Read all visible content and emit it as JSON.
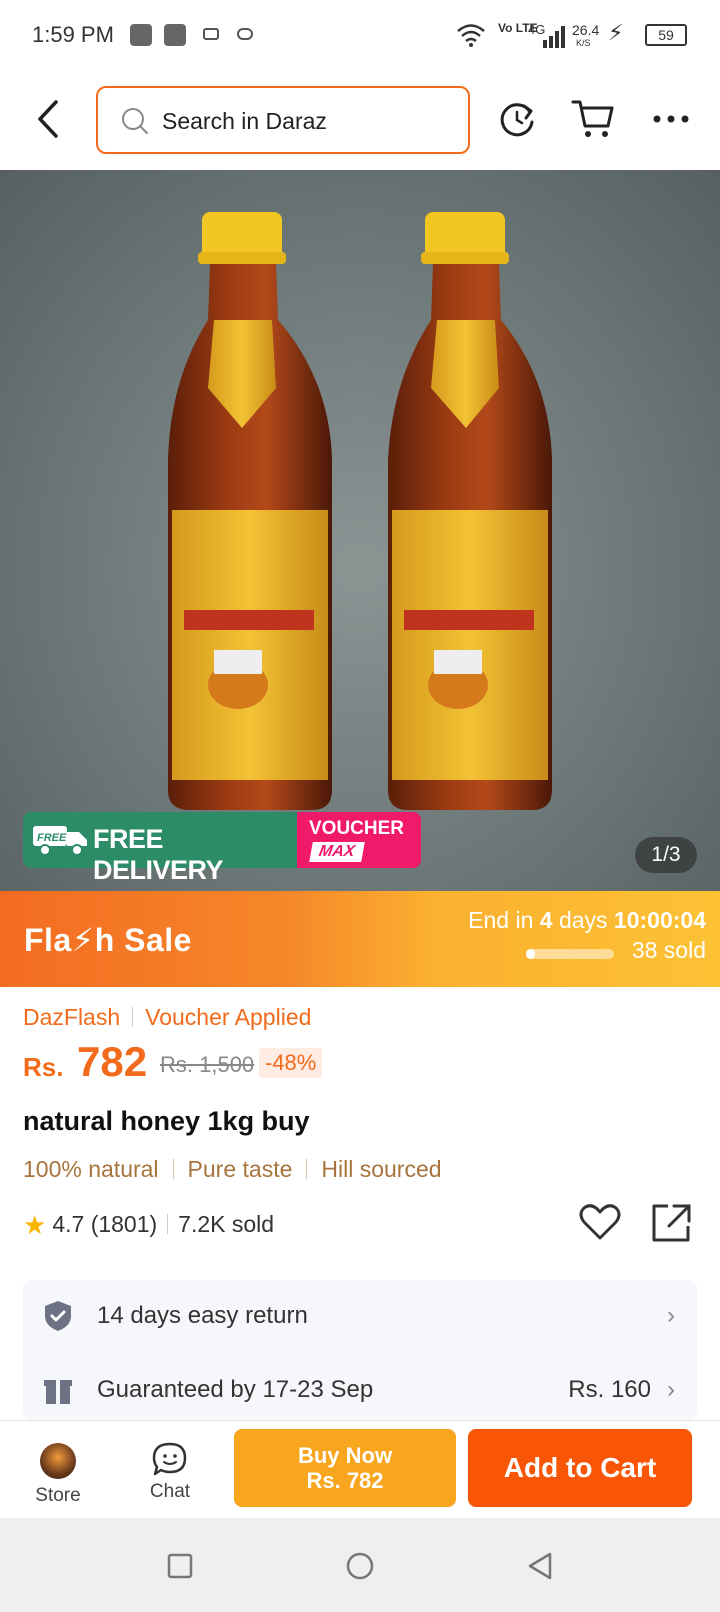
{
  "status_bar": {
    "time": "1:59 PM",
    "network_speed": "26.4",
    "network_speed_unit": "K/S",
    "network_type": "4G",
    "volte": "Vo LTE",
    "battery": "59"
  },
  "header": {
    "search_placeholder": "Search in Daraz"
  },
  "gallery": {
    "pager": "1/3",
    "badge_free_small": "FREE",
    "badge_free_delivery": "FREE DELIVERY",
    "badge_voucher": "VOUCHER",
    "badge_voucher_max": "MAX"
  },
  "flash_sale": {
    "title": "Fla⚡h  Sale",
    "end_prefix": "End in",
    "end_days": "4",
    "end_days_label": "days",
    "end_time": "10:00:04",
    "sold": "38 sold",
    "progress": 0.1
  },
  "product": {
    "tag_1": "DazFlash",
    "tag_2": "Voucher Applied",
    "currency": "Rs.",
    "price": "782",
    "old_price": "Rs. 1,500",
    "discount": "-48%",
    "title": "natural honey 1kg buy",
    "features": [
      "100% natural",
      "Pure taste",
      "Hill sourced"
    ],
    "rating": "4.7",
    "reviews": "(1801)",
    "sold": "7.2K sold"
  },
  "services": {
    "return_text": "14 days easy return",
    "delivery_text": "Guaranteed by 17-23 Sep",
    "delivery_price": "Rs. 160"
  },
  "bottom_bar": {
    "store_label": "Store",
    "chat_label": "Chat",
    "buy_now_label": "Buy Now",
    "buy_now_price": "Rs. 782",
    "add_to_cart_label": "Add to Cart"
  },
  "colors": {
    "brand_orange": "#f85606",
    "buy_now": "#f9a61f",
    "free_delivery_green": "#2d8c68",
    "voucher_pink": "#f0196a",
    "feature_brown": "#a8743d"
  },
  "icons": {
    "back": "chevron-left-icon",
    "search": "search-icon",
    "refresh": "refresh-icon",
    "cart": "cart-icon",
    "more": "more-dots-icon",
    "favorite": "heart-icon",
    "share": "share-icon",
    "return": "shield-check-icon",
    "delivery": "package-icon",
    "chat": "chat-bubble-icon"
  }
}
